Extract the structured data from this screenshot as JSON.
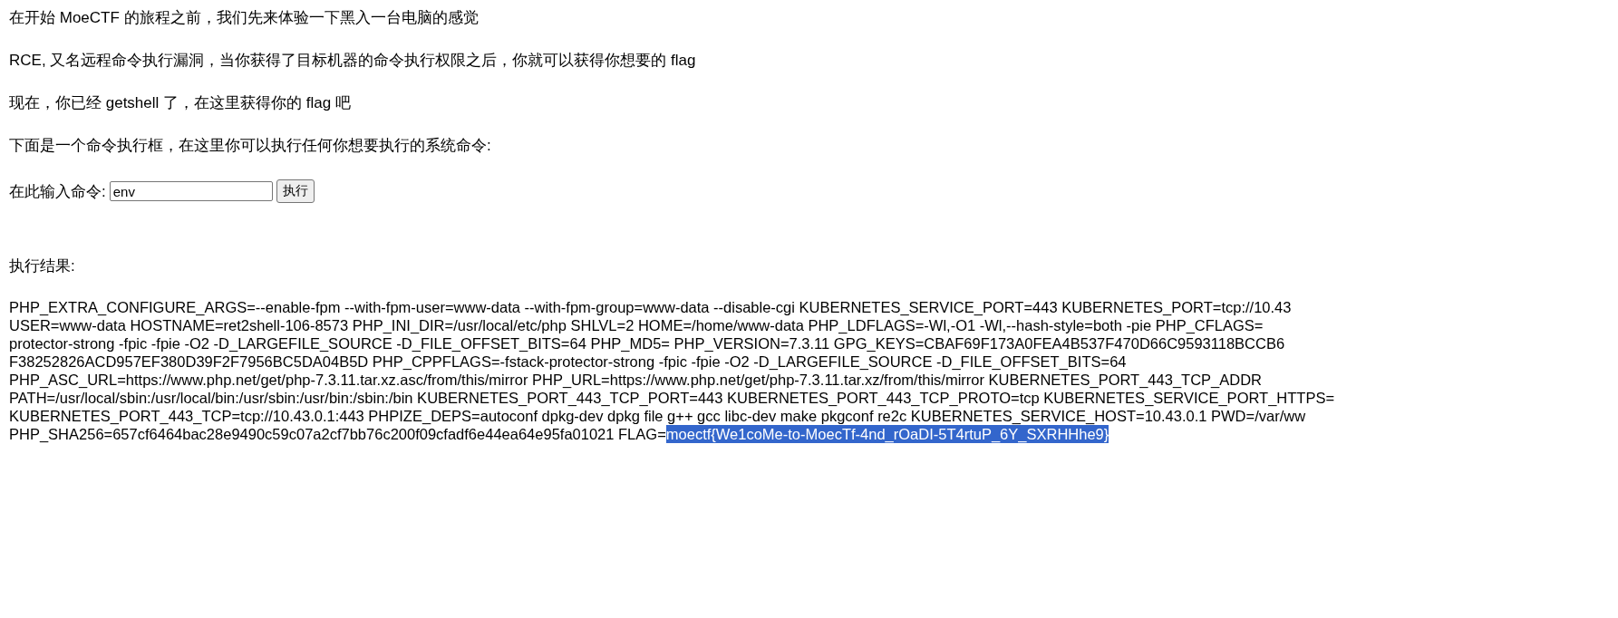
{
  "paragraphs": [
    "在开始 MoeCTF 的旅程之前，我们先来体验一下黑入一台电脑的感觉",
    "RCE, 又名远程命令执行漏洞，当你获得了目标机器的命令执行权限之后，你就可以获得你想要的 flag",
    "现在，你已经 getshell 了，在这里获得你的 flag 吧",
    "下面是一个命令执行框，在这里你可以执行任何你想要执行的系统命令:"
  ],
  "command_form": {
    "label": "在此输入命令:",
    "value": "env",
    "button": "执行"
  },
  "result_label": "执行结果:",
  "output_lines": [
    "PHP_EXTRA_CONFIGURE_ARGS=--enable-fpm --with-fpm-user=www-data --with-fpm-group=www-data --disable-cgi KUBERNETES_SERVICE_PORT=443 KUBERNETES_PORT=tcp://10.43",
    "USER=www-data HOSTNAME=ret2shell-106-8573 PHP_INI_DIR=/usr/local/etc/php SHLVL=2 HOME=/home/www-data PHP_LDFLAGS=-Wl,-O1 -Wl,--hash-style=both -pie PHP_CFLAGS=",
    "protector-strong -fpic -fpie -O2 -D_LARGEFILE_SOURCE -D_FILE_OFFSET_BITS=64 PHP_MD5= PHP_VERSION=7.3.11 GPG_KEYS=CBAF69F173A0FEA4B537F470D66C9593118BCCB6",
    "F38252826ACD957EF380D39F2F7956BC5DA04B5D PHP_CPPFLAGS=-fstack-protector-strong -fpic -fpie -O2 -D_LARGEFILE_SOURCE -D_FILE_OFFSET_BITS=64",
    "PHP_ASC_URL=https://www.php.net/get/php-7.3.11.tar.xz.asc/from/this/mirror PHP_URL=https://www.php.net/get/php-7.3.11.tar.xz/from/this/mirror KUBERNETES_PORT_443_TCP_ADDR",
    "PATH=/usr/local/sbin:/usr/local/bin:/usr/sbin:/usr/bin:/sbin:/bin KUBERNETES_PORT_443_TCP_PORT=443 KUBERNETES_PORT_443_TCP_PROTO=tcp KUBERNETES_SERVICE_PORT_HTTPS=",
    "KUBERNETES_PORT_443_TCP=tcp://10.43.0.1:443 PHPIZE_DEPS=autoconf dpkg-dev dpkg file g++ gcc libc-dev make pkgconf re2c KUBERNETES_SERVICE_HOST=10.43.0.1 PWD=/var/ww",
    "PHP_SHA256=657cf6464bac28e9490c59c07a2cf7bb76c200f09cfadf6e44ea64e95fa01021 FLAG="
  ],
  "flag": {
    "text": "moectf{We1coMe-to-MoecTf-4nd_rOaDI-5T4rtuP_6Y_SXRHHhe9}",
    "selected": true
  }
}
